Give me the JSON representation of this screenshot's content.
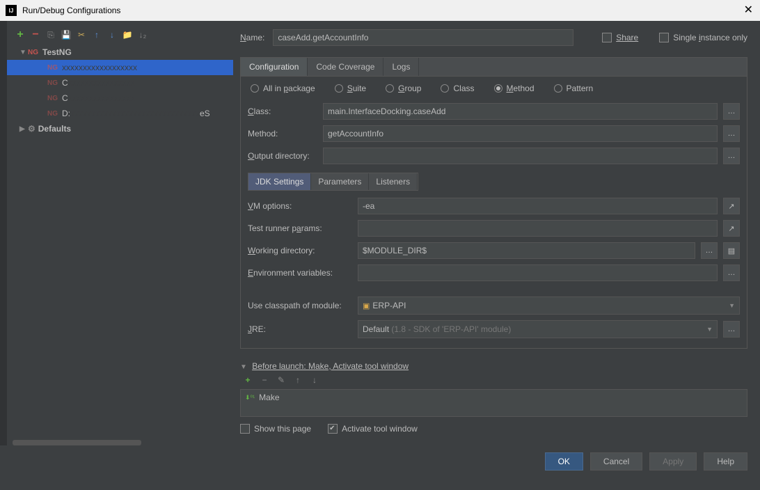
{
  "window": {
    "title": "Run/Debug Configurations"
  },
  "sidebar": {
    "testng_label": "TestNG",
    "defaults_label": "Defaults",
    "items": [
      {
        "prefix": "",
        "obscured": true
      },
      {
        "prefix": "C",
        "obscured": true
      },
      {
        "prefix": "C",
        "obscured": true
      },
      {
        "prefix": "D:",
        "rest": "eS"
      }
    ]
  },
  "name": {
    "label": "Name:",
    "value": "caseAdd.getAccountInfo"
  },
  "share": {
    "label": "Share"
  },
  "single": {
    "label": "Single instance only"
  },
  "tabs": {
    "configuration": "Configuration",
    "code_coverage": "Code Coverage",
    "logs": "Logs"
  },
  "radios": {
    "all": "All in package",
    "suite": "Suite",
    "group": "Group",
    "clazz": "Class",
    "method": "Method",
    "pattern": "Pattern"
  },
  "form": {
    "class_label": "Class:",
    "class_value": "main.InterfaceDocking.caseAdd",
    "method_label": "Method:",
    "method_value": "getAccountInfo",
    "output_label": "Output directory:",
    "output_value": ""
  },
  "subtabs": {
    "jdk": "JDK Settings",
    "params": "Parameters",
    "listeners": "Listeners"
  },
  "jdk": {
    "vm_label": "VM options:",
    "vm_value": "-ea",
    "runner_label": "Test runner params:",
    "runner_value": "",
    "wd_label": "Working directory:",
    "wd_value": "$MODULE_DIR$",
    "env_label": "Environment variables:",
    "env_value": "",
    "classpath_label": "Use classpath of module:",
    "classpath_value": "ERP-API",
    "jre_label": "JRE:",
    "jre_prefix": "Default ",
    "jre_suffix": "(1.8 - SDK of 'ERP-API' module)"
  },
  "before": {
    "header": "Before launch: Make, Activate tool window",
    "item": "Make"
  },
  "footer": {
    "show_page": "Show this page",
    "activate": "Activate tool window"
  },
  "buttons": {
    "ok": "OK",
    "cancel": "Cancel",
    "apply": "Apply",
    "help": "Help"
  }
}
